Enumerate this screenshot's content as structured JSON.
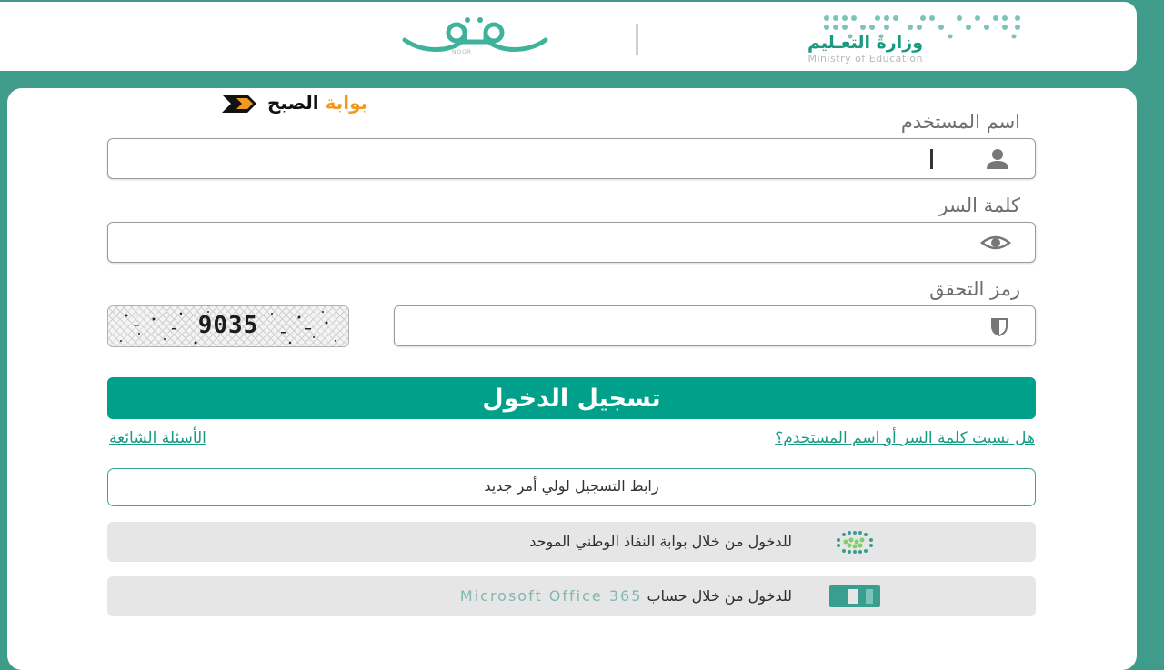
{
  "header": {
    "noor_caption": "NOOR",
    "ministry_ar": "وزارة التعـليم",
    "ministry_en": "Ministry of Education"
  },
  "watermark": {
    "dark": "الصبح",
    "orange": "بوابة"
  },
  "form": {
    "username_label": "اسم المستخدم",
    "username_value": "",
    "password_label": "كلمة السر",
    "password_value": "",
    "captcha_label": "رمز التحقق",
    "captcha_value": "",
    "captcha_code": "9035"
  },
  "login_button": "تسجيل الدخول",
  "links": {
    "forgot": "هل نسيت كلمة السر أو اسم المستخدم؟",
    "faq": "الأسئلة الشائعة"
  },
  "parent_registration": "رابط التسجيل لولي أمر جديد",
  "nafath_login": "للدخول من خلال بوابة النفاذ الوطني الموحد",
  "office_login": {
    "prefix": "للدخول من خلال حساب",
    "suffix": "Microsoft Office 365"
  },
  "icons": {
    "username": "user-icon",
    "password": "eye-icon",
    "captcha": "shield-icon",
    "nafath": "nafath-logo-icon",
    "office": "office-icon"
  },
  "colors": {
    "brand_teal": "#00a08a",
    "background": "#3f9c8a",
    "watermark_orange": "#f39a1e"
  }
}
